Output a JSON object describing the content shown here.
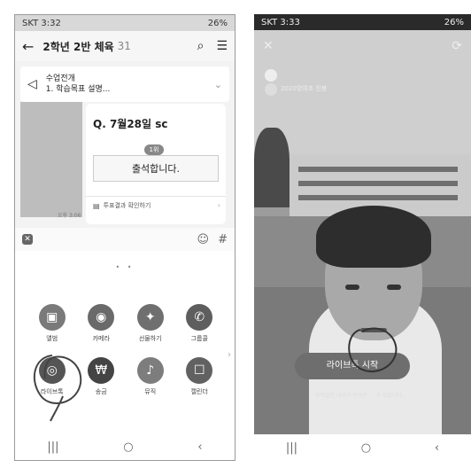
{
  "left": {
    "status": {
      "carrier_time": "SKT 3:32",
      "battery": "26%"
    },
    "header": {
      "back": "←",
      "title": "2학년 2반 체육",
      "member_count": "31",
      "search_icon": "search-icon",
      "menu_icon": "menu-icon"
    },
    "notice": {
      "label": "수업전개",
      "text": "1. 학습목표 설명..."
    },
    "vote": {
      "question": "Q. 7월28일 sc",
      "rank_badge": "1위",
      "option": "출석합니다.",
      "result_link": "투표결과 확인하기",
      "time": "오후 3:06"
    },
    "toolbar": {
      "close": "✕",
      "emoji": "☺",
      "hash": "#"
    },
    "drawer": {
      "page_dots": "• •",
      "items": [
        {
          "label": "앨범",
          "icon": "album-icon",
          "glyph": "▣",
          "color": "#7a7a7a"
        },
        {
          "label": "카메라",
          "icon": "camera-icon",
          "glyph": "◉",
          "color": "#6a6a6a"
        },
        {
          "label": "선물하기",
          "icon": "gift-icon",
          "glyph": "✦",
          "color": "#6f6f6f"
        },
        {
          "label": "그룹콜",
          "icon": "phone-icon",
          "glyph": "✆",
          "color": "#5e5e5e"
        },
        {
          "label": "라이브톡",
          "icon": "live-talk-icon",
          "glyph": "◎",
          "color": "#555555"
        },
        {
          "label": "송금",
          "icon": "money-icon",
          "glyph": "₩",
          "color": "#444444"
        },
        {
          "label": "뮤직",
          "icon": "music-icon",
          "glyph": "♪",
          "color": "#7d7d7d"
        },
        {
          "label": "캘린더",
          "icon": "calendar-icon",
          "glyph": "☐",
          "color": "#616161"
        }
      ],
      "more": "›"
    },
    "nav": {
      "recent": "|||",
      "home": "○",
      "back": "‹"
    }
  },
  "right": {
    "status": {
      "carrier_time": "SKT 3:33",
      "battery": "26%"
    },
    "close": "✕",
    "rotate": "⟳",
    "room": "2020양여초 진봉",
    "start_button": "라이브톡 시작",
    "disclaimer": "부적절한 내용의 방송은 ... 수 있습니다.",
    "nav": {
      "recent": "|||",
      "home": "○",
      "back": "‹"
    }
  }
}
